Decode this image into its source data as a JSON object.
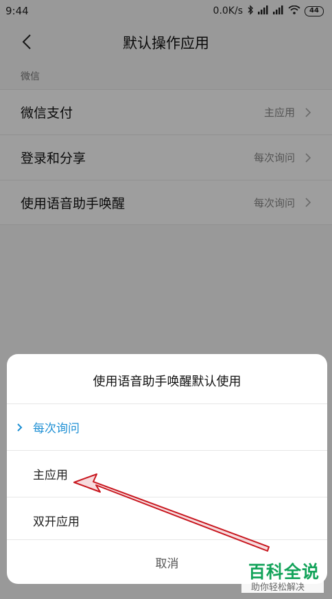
{
  "status": {
    "time": "9:44",
    "speed": "0.0K/s",
    "battery": "44"
  },
  "nav": {
    "title": "默认操作应用"
  },
  "section": {
    "label": "微信"
  },
  "rows": [
    {
      "label": "微信支付",
      "value": "主应用"
    },
    {
      "label": "登录和分享",
      "value": "每次询问"
    },
    {
      "label": "使用语音助手唤醒",
      "value": "每次询问"
    }
  ],
  "dialog": {
    "title": "使用语音助手唤醒默认使用",
    "options": [
      {
        "label": "每次询问",
        "selected": true
      },
      {
        "label": "主应用",
        "selected": false
      },
      {
        "label": "双开应用",
        "selected": false
      }
    ],
    "cancel": "取消"
  },
  "watermark": {
    "main": "百科全说",
    "sub": "助你轻松解决"
  },
  "colors": {
    "accent": "#1d8fd4",
    "annotation": "#c8171f",
    "watermark": "#13a35a"
  },
  "icons": [
    "back-arrow-icon",
    "chevron-right-icon",
    "bluetooth-icon",
    "signal-icon",
    "wifi-icon",
    "battery-icon",
    "check-chevron-icon"
  ]
}
